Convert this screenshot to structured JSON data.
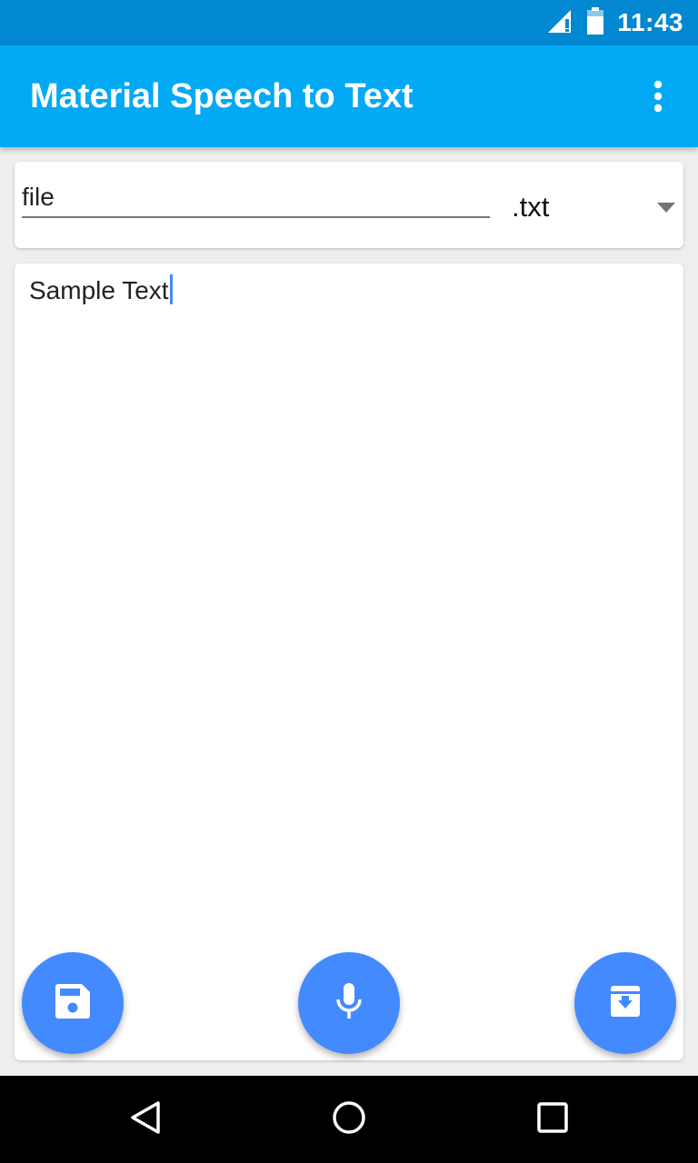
{
  "status_bar": {
    "time": "11:43",
    "icons": [
      "signal-icon",
      "battery-icon"
    ]
  },
  "app_bar": {
    "title": "Material Speech to Text",
    "overflow_icon": "more-vert-icon"
  },
  "file_card": {
    "filename_value": "file",
    "extension_selected": ".txt"
  },
  "editor": {
    "text": "Sample Text"
  },
  "fabs": [
    {
      "icon": "save-icon"
    },
    {
      "icon": "mic-icon"
    },
    {
      "icon": "archive-download-icon"
    }
  ],
  "nav_bar": {
    "icons": [
      "back-icon",
      "home-icon",
      "recents-icon"
    ]
  },
  "colors": {
    "status_bar": "#0288d1",
    "app_bar": "#03a9f4",
    "fab": "#448aff",
    "background": "#eeeeee"
  }
}
